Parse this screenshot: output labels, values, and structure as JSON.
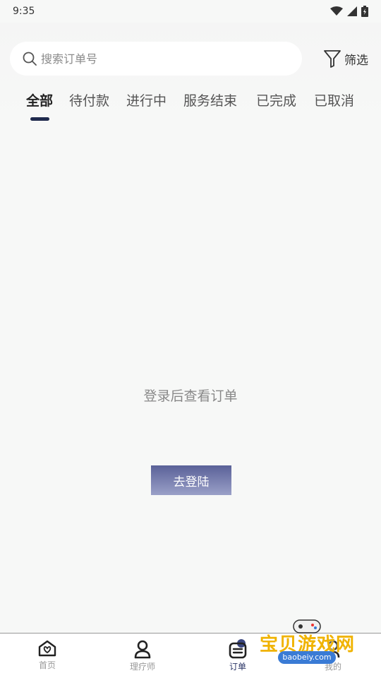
{
  "status_bar": {
    "time": "9:35"
  },
  "search": {
    "placeholder": "搜索订单号"
  },
  "filter": {
    "label": "筛选"
  },
  "tabs": [
    {
      "label": "全部",
      "active": true
    },
    {
      "label": "待付款",
      "active": false
    },
    {
      "label": "进行中",
      "active": false
    },
    {
      "label": "服务结束",
      "active": false
    },
    {
      "label": "已完成",
      "active": false
    },
    {
      "label": "已取消",
      "active": false
    }
  ],
  "empty_state": {
    "message": "登录后查看订单",
    "login_button": "去登陆"
  },
  "bottom_nav": [
    {
      "label": "首页",
      "icon": "home-icon",
      "active": false
    },
    {
      "label": "理疗师",
      "icon": "person-icon",
      "active": false
    },
    {
      "label": "订单",
      "icon": "order-icon",
      "active": true
    },
    {
      "label": "我的",
      "icon": "profile-icon",
      "active": false
    }
  ],
  "watermark": {
    "title": "宝贝游戏网",
    "url": "baobeiy.com"
  },
  "colors": {
    "accent": "#1f2a4d",
    "button_gradient_top": "#5a6198",
    "button_gradient_bottom": "#9aa0c8",
    "background": "#f7f8f7"
  }
}
